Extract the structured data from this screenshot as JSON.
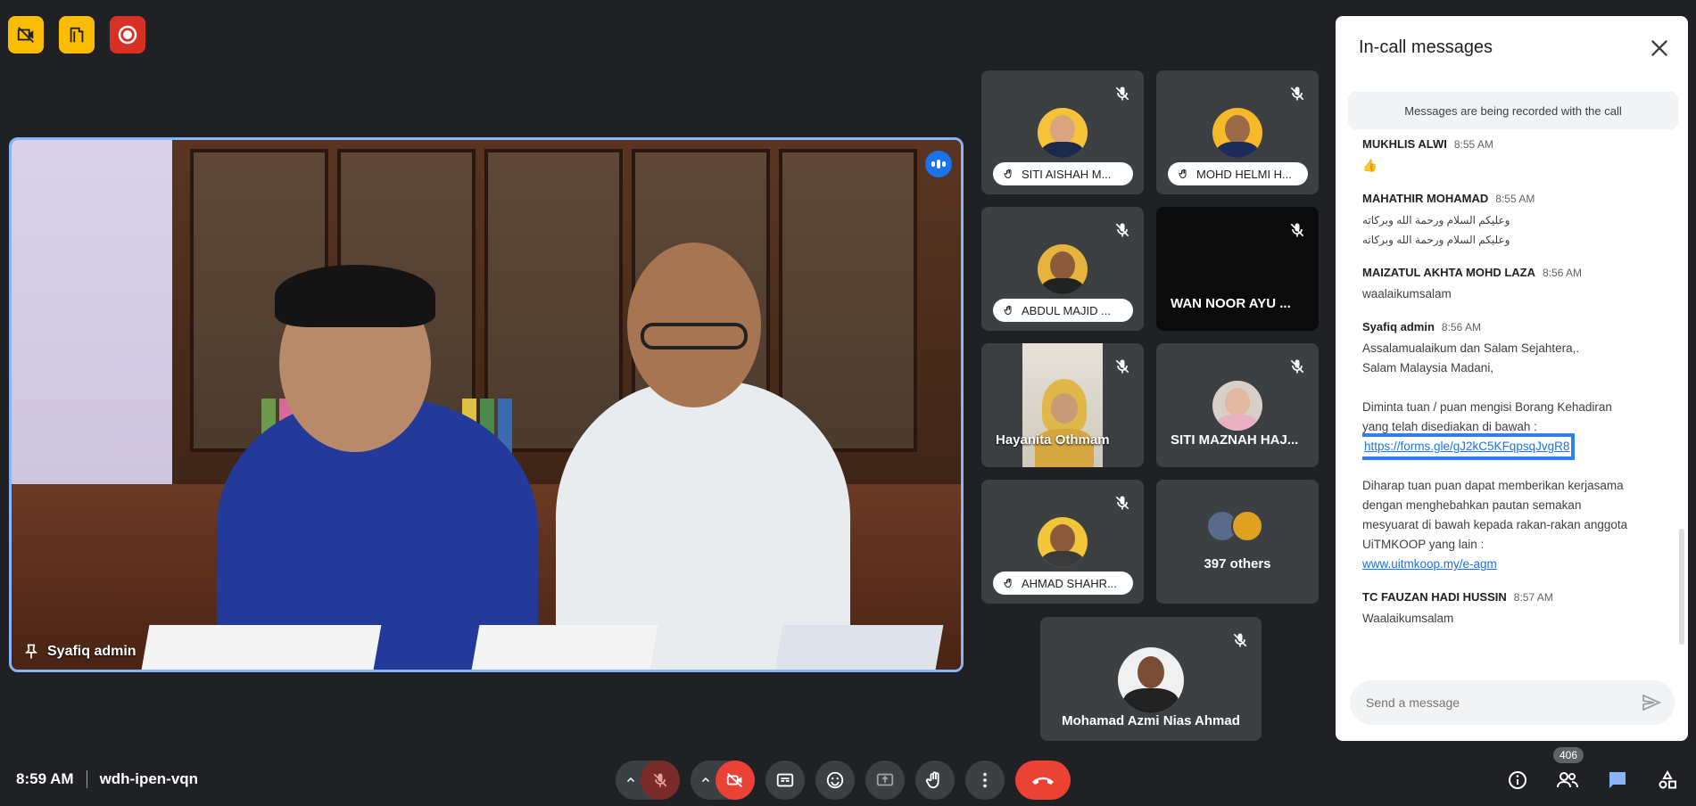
{
  "meeting": {
    "time": "8:59 AM",
    "code": "wdh-ipen-vqn",
    "participant_count": "406"
  },
  "main_speaker": {
    "name": "Syafiq admin"
  },
  "tiles": [
    {
      "name": "SITI AISHAH M...",
      "style": "pill"
    },
    {
      "name": "MOHD HELMI H...",
      "style": "pill"
    },
    {
      "name": "ABDUL MAJID ...",
      "style": "pill"
    },
    {
      "name": "WAN NOOR AYU ...",
      "style": "plain"
    },
    {
      "name": "Hayanita Othmam",
      "style": "plain"
    },
    {
      "name": "SITI MAZNAH HAJ...",
      "style": "plain"
    },
    {
      "name": "AHMAD SHAHR...",
      "style": "pill"
    },
    {
      "name": "397 others",
      "style": "plain"
    },
    {
      "name": "Mohamad Azmi Nias Ahmad",
      "style": "plain"
    }
  ],
  "chat": {
    "title": "In-call messages",
    "recording_notice": "Messages are being recorded with the call",
    "send_placeholder": "Send a message",
    "messages": [
      {
        "sender": "MUKHLIS ALWI",
        "time": "8:55 AM",
        "lines": [
          "👍"
        ]
      },
      {
        "sender": "MAHATHIR MOHAMAD",
        "time": "8:55 AM",
        "lines": [
          "وعليكم السلام ورحمة الله وبركاته",
          "وعليكم السلام ورحمة الله وبركاته"
        ]
      },
      {
        "sender": "MAIZATUL AKHTA MOHD LAZA",
        "time": "8:56 AM",
        "lines": [
          "waalaikumsalam"
        ]
      },
      {
        "sender": "Syafiq admin",
        "time": "8:56 AM",
        "lines": [
          "Assalamualaikum dan Salam Sejahtera,.",
          "Salam Malaysia Madani,",
          "",
          "Diminta tuan / puan mengisi Borang Kehadiran",
          "yang telah disediakan di bawah :"
        ],
        "link1": "https://forms.gle/gJ2kC5KFqpsqJvgR8",
        "lines2": [
          "",
          "Diharap tuan puan dapat memberikan kerjasama",
          "dengan menghebahkan pautan semakan",
          "mesyuarat di bawah kepada rakan-rakan anggota",
          "UiTMKOOP yang lain :"
        ],
        "link2": "www.uitmkoop.my/e-agm"
      },
      {
        "sender": "TC FAUZAN HADI HUSSIN",
        "time": "8:57 AM",
        "lines": [
          "Waalaikumsalam"
        ]
      }
    ]
  },
  "colors": {
    "accent": "#8ab4f8",
    "link": "#1a73e8",
    "danger": "#ea4335",
    "badge_yellow": "#fbbc04"
  },
  "icons": {
    "top_badges": [
      "no-camera-icon",
      "building-icon",
      "record-icon"
    ],
    "controls": [
      "mic-off-icon",
      "camera-off-icon",
      "captions-icon",
      "emoji-icon",
      "present-icon",
      "raise-hand-icon",
      "more-options-icon",
      "end-call-icon"
    ],
    "right": [
      "info-icon",
      "people-icon",
      "chat-icon",
      "activities-icon"
    ]
  }
}
